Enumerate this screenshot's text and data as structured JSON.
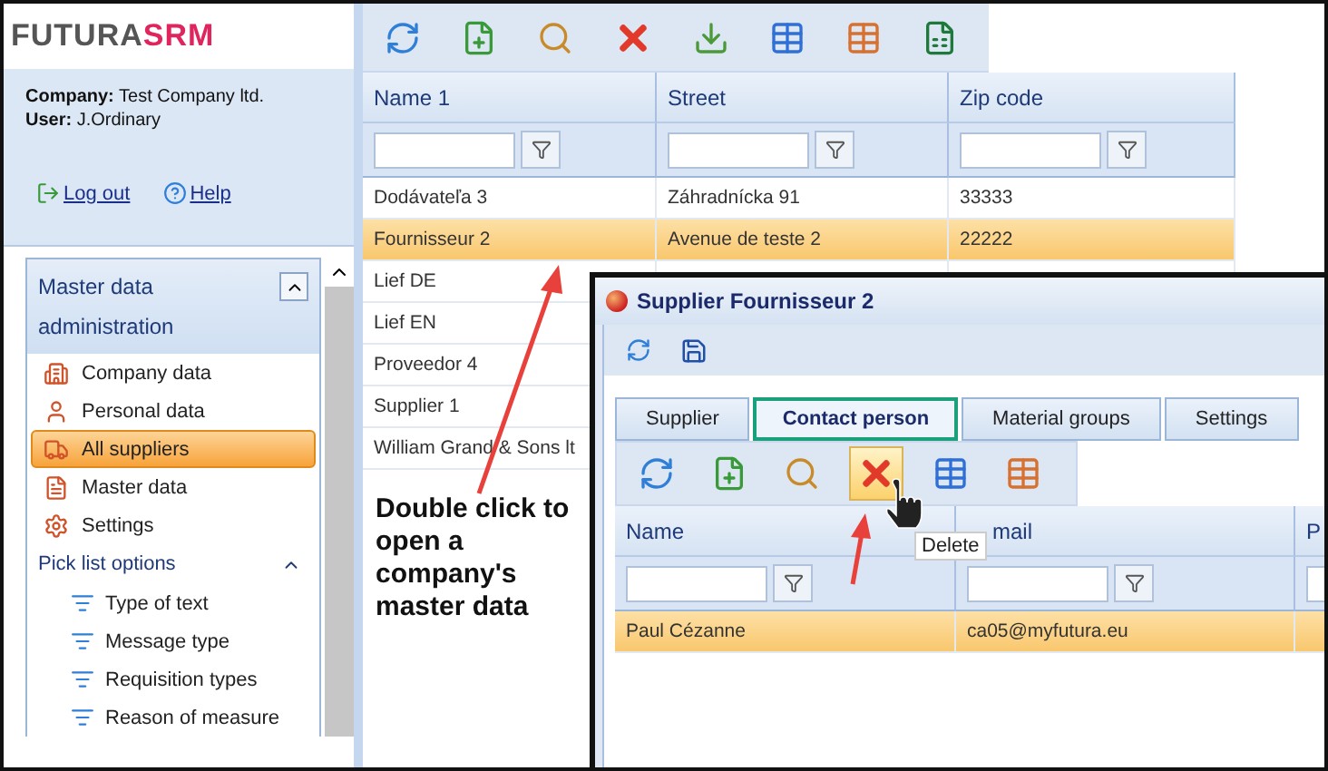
{
  "sidebar": {
    "logo": {
      "part_1": "FUTURA",
      "part_2": "SRM"
    },
    "info": [
      {
        "label": "Company:",
        "value": "Test Company ltd."
      },
      {
        "label": "User:",
        "value": "J.Ordinary"
      }
    ],
    "links": [
      "Log out",
      "Help"
    ],
    "panel": {
      "title": "Master data administration",
      "expanded": true,
      "items": [
        {
          "label": "Company data",
          "selected": false
        },
        {
          "label": "Personal data",
          "selected": false
        },
        {
          "label": "All suppliers",
          "selected": true
        },
        {
          "label": "Master data",
          "selected": false
        },
        {
          "label": "Settings",
          "selected": false
        }
      ],
      "section": {
        "title": "Pick list options",
        "expanded": true,
        "items": [
          "Type of text",
          "Message type",
          "Requisition types",
          "Reason of measure"
        ]
      }
    }
  },
  "table": {
    "columns": [
      "Name 1",
      "Street",
      "Zip code"
    ],
    "rows": [
      {
        "cells": [
          "Dodávateľa 3",
          "Záhradnícka 91",
          "33333"
        ],
        "selected": false
      },
      {
        "cells": [
          "Fournisseur 2",
          "Avenue de teste 2",
          "22222"
        ],
        "selected": true
      },
      {
        "cells": [
          "Lief DE"
        ],
        "selected": false
      },
      {
        "cells": [
          "Lief EN"
        ],
        "selected": false
      },
      {
        "cells": [
          "Proveedor 4"
        ],
        "selected": false
      },
      {
        "cells": [
          "Supplier 1"
        ],
        "selected": false
      },
      {
        "cells": [
          "William Grand & Sons lt"
        ],
        "selected": false
      }
    ]
  },
  "annotation": "Double click to open a company's master data",
  "dialog": {
    "title": "Supplier Fournisseur 2",
    "tabs": [
      {
        "label": "Supplier",
        "selected": false
      },
      {
        "label": "Contact person",
        "selected": true
      },
      {
        "label": "Material groups",
        "selected": false
      },
      {
        "label": "Settings",
        "selected": false
      }
    ],
    "columns": [
      "Name",
      "mail",
      "P"
    ],
    "rows": [
      {
        "cells": [
          "Paul Cézanne",
          "ca05@myfutura.eu"
        ],
        "selected": true
      }
    ],
    "tooltip": "Delete"
  }
}
